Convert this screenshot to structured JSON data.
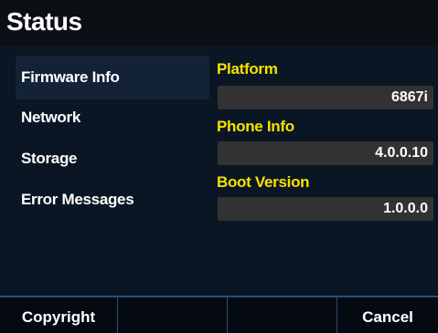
{
  "header": {
    "title": "Status"
  },
  "menu": {
    "items": [
      {
        "label": "Firmware Info",
        "selected": true
      },
      {
        "label": "Network",
        "selected": false
      },
      {
        "label": "Storage",
        "selected": false
      },
      {
        "label": "Error Messages",
        "selected": false
      }
    ]
  },
  "details": {
    "fields": [
      {
        "label": "Platform",
        "value": "6867i"
      },
      {
        "label": "Phone Info",
        "value": "4.0.0.10"
      },
      {
        "label": "Boot Version",
        "value": "1.0.0.0"
      }
    ]
  },
  "softkeys": [
    "Copyright",
    "",
    "",
    "Cancel"
  ],
  "colors": {
    "label_yellow": "#f5e100",
    "selected_bg": "#142238",
    "field_bg": "#323232",
    "divider_blue": "#2e4d72"
  }
}
